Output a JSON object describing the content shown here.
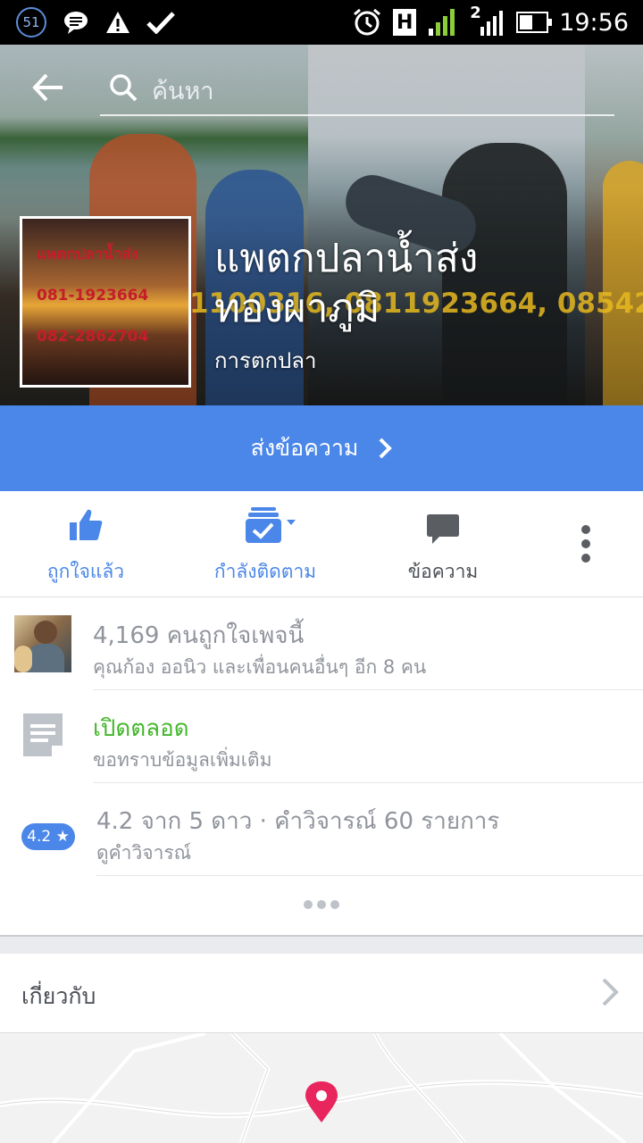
{
  "status_bar": {
    "notification_count": "51",
    "time": "19:56",
    "network_type": "H",
    "sim2_label": "2",
    "icons": [
      "message-icon",
      "warning-icon",
      "check-icon",
      "alarm-icon",
      "signal-icon",
      "battery-icon"
    ]
  },
  "header": {
    "search_placeholder": "ค้นหา"
  },
  "cover": {
    "overlay_text": "1100316, 0811923664, 08542",
    "profile_text": [
      "แพตกปลาน้ำส่ง",
      "081-1923664",
      "082-2862704"
    ]
  },
  "page": {
    "name": "แพตกปลาน้ำส่ง ทองผาภูมิ",
    "category": "การตกปลา"
  },
  "message_button": {
    "label": "ส่งข้อความ"
  },
  "actions": [
    {
      "label": "ถูกใจแล้ว",
      "icon": "like-icon",
      "color": "#4b87e8"
    },
    {
      "label": "กำลังติดตาม",
      "icon": "following-icon",
      "color": "#4b87e8"
    },
    {
      "label": "ข้อความ",
      "icon": "message-icon",
      "color": "#4b4f56"
    }
  ],
  "info": {
    "likes": {
      "title": "4,169 คนถูกใจเพจนี้",
      "subtitle": "คุณก้อง ออนิว และเพื่อนคนอื่นๆ อีก 8 คน"
    },
    "hours": {
      "title": "เปิดตลอด",
      "subtitle": "ขอทราบข้อมูลเพิ่มเติม",
      "title_color": "#42b72a"
    },
    "rating": {
      "badge": "4.2 ★",
      "title": "4.2 จาก 5 ดาว · คำวิจารณ์ 60 รายการ",
      "subtitle": "ดูคำวิจารณ์"
    }
  },
  "about": {
    "label": "เกี่ยวกับ"
  },
  "colors": {
    "accent": "#4b87e8",
    "pin": "#e8265d"
  }
}
